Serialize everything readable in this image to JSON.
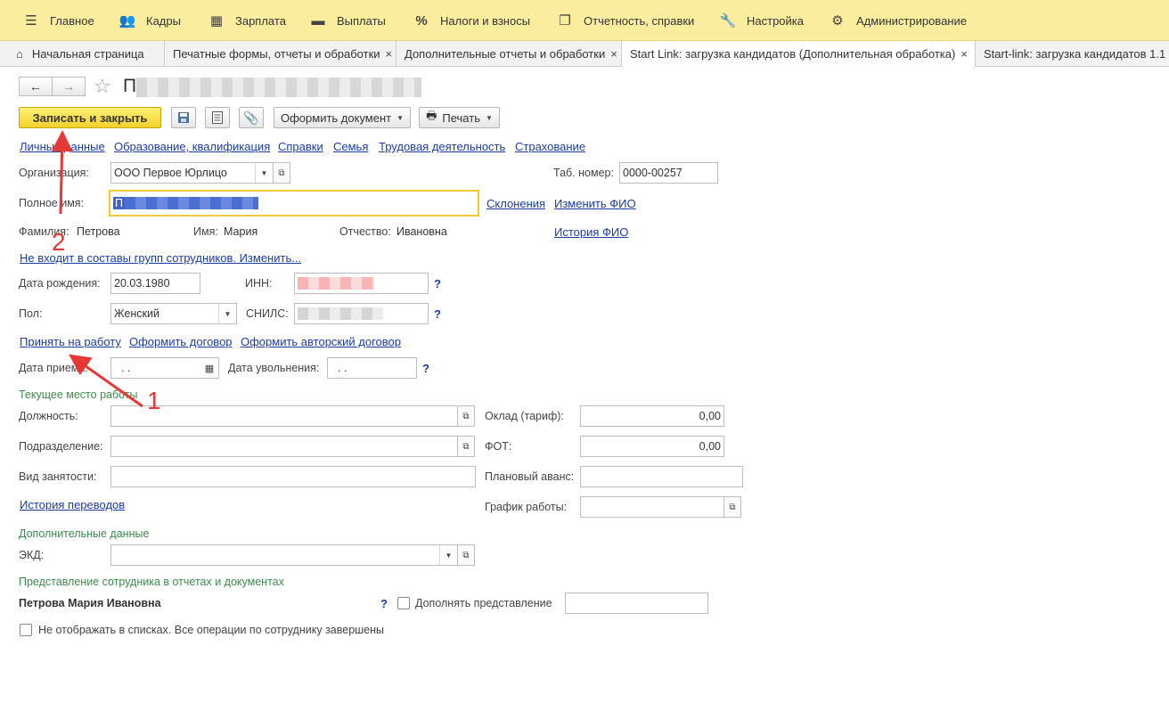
{
  "menu": [
    {
      "label": "Главное",
      "icon": "hamburger-icon"
    },
    {
      "label": "Кадры",
      "icon": "people-icon"
    },
    {
      "label": "Зарплата",
      "icon": "calculator-icon"
    },
    {
      "label": "Выплаты",
      "icon": "wallet-icon"
    },
    {
      "label": "Налоги и взносы",
      "icon": "percent-icon"
    },
    {
      "label": "Отчетность, справки",
      "icon": "reports-icon"
    },
    {
      "label": "Настройка",
      "icon": "wrench-icon"
    },
    {
      "label": "Администрирование",
      "icon": "gear-icon"
    }
  ],
  "tabs": [
    {
      "label": "Начальная страница"
    },
    {
      "label": "Печатные формы, отчеты и обработки",
      "close": "×"
    },
    {
      "label": "Дополнительные отчеты и обработки",
      "close": "×"
    },
    {
      "label": "Start Link: загрузка кандидатов (Дополнительная обработка)",
      "close": "×"
    },
    {
      "label": "Start-link: загрузка кандидатов 1.1"
    }
  ],
  "toolbar": {
    "back": "←",
    "forward": "→",
    "star": "☆",
    "title_initial": "П",
    "save_close": "Записать и закрыть",
    "make_doc": "Оформить документ",
    "print": "Печать"
  },
  "section_links": [
    "Личные данные",
    "Образование, квалификация",
    "Справки",
    "Семья",
    "Трудовая деятельность",
    "Страхование"
  ],
  "form": {
    "org_label": "Организация:",
    "org_value": "ООО Первое Юрлицо",
    "tab_label": "Таб. номер:",
    "tab_value": "0000-00257",
    "fullname_label": "Полное имя:",
    "fullname_value": "П",
    "declensions": "Склонения",
    "change_fio": "Изменить ФИО",
    "surname_label": "Фамилия:",
    "surname_value": "Петрова",
    "name_label": "Имя:",
    "name_value": "Мария",
    "patronymic_label": "Отчество:",
    "patronymic_value": "Ивановна",
    "history_fio": "История ФИО",
    "groups_link": "Не входит в составы групп сотрудников. Изменить...",
    "birth_label": "Дата рождения:",
    "birth_value": "20.03.1980",
    "inn_label": "ИНН:",
    "snils_label": "СНИЛС:",
    "gender_label": "Пол:",
    "gender_value": "Женский",
    "q": "?",
    "hire_link": "Принять на работу",
    "contract_link": "Оформить договор",
    "author_contract_link": "Оформить авторский договор",
    "hire_date_label": "Дата приема:",
    "hire_date_value": " .  .",
    "dismiss_label": "Дата увольнения:",
    "dismiss_value": " .  .",
    "current_job_section": "Текущее место работы",
    "position_label": "Должность:",
    "salary_label": "Оклад (тариф):",
    "salary_value": "0,00",
    "dept_label": "Подразделение:",
    "fot_label": "ФОТ:",
    "fot_value": "0,00",
    "employment_label": "Вид занятости:",
    "advance_label": "Плановый аванс:",
    "transfers_link": "История переводов",
    "schedule_label": "График работы:",
    "extra_section": "Дополнительные данные",
    "ekd_label": "ЭКД:",
    "repr_section": "Представление сотрудника в отчетах и документах",
    "repr_value": "Петрова Мария Ивановна",
    "supplement_label": "Дополнять представление",
    "hide_label": "Не отображать в списках. Все операции по сотруднику завершены"
  },
  "annotations": [
    {
      "label": "1",
      "color": "#e53935"
    },
    {
      "label": "2",
      "color": "#e53935"
    }
  ]
}
